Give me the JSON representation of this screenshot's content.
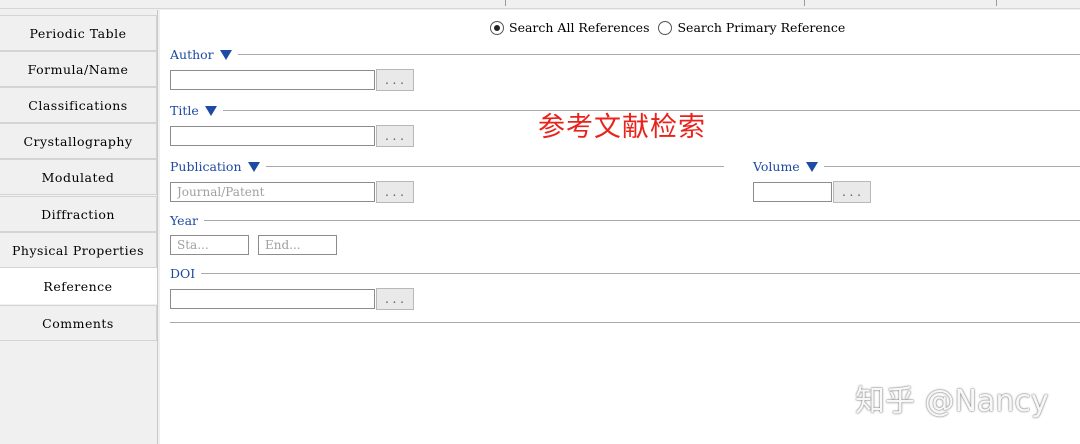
{
  "sidebar": {
    "items": [
      {
        "label": "Periodic Table"
      },
      {
        "label": "Formula/Name"
      },
      {
        "label": "Classifications"
      },
      {
        "label": "Crystallography"
      },
      {
        "label": "Modulated"
      },
      {
        "label": "Diffraction"
      },
      {
        "label": "Physical Properties"
      },
      {
        "label": "Reference",
        "active": true
      },
      {
        "label": "Comments"
      }
    ]
  },
  "search_mode": {
    "options": [
      {
        "label": "Search All References",
        "selected": true
      },
      {
        "label": "Search Primary Reference",
        "selected": false
      }
    ]
  },
  "sections": {
    "author": {
      "label": "Author",
      "value": "",
      "browse": "..."
    },
    "title": {
      "label": "Title",
      "value": "",
      "browse": "..."
    },
    "publication": {
      "label": "Publication",
      "value": "",
      "placeholder": "Journal/Patent",
      "browse": "..."
    },
    "volume": {
      "label": "Volume",
      "value": "",
      "browse": "..."
    },
    "year": {
      "label": "Year",
      "start_placeholder": "Sta...",
      "end_placeholder": "End..."
    },
    "doi": {
      "label": "DOI",
      "value": "",
      "browse": "..."
    }
  },
  "annotation": {
    "text": "参考文献检索",
    "color": "#e8231c"
  },
  "watermark": {
    "text": "知乎 @Nancy"
  },
  "colors": {
    "section_label": "#1d4aa2",
    "background": "#f0f0f0",
    "panel": "#ffffff"
  }
}
